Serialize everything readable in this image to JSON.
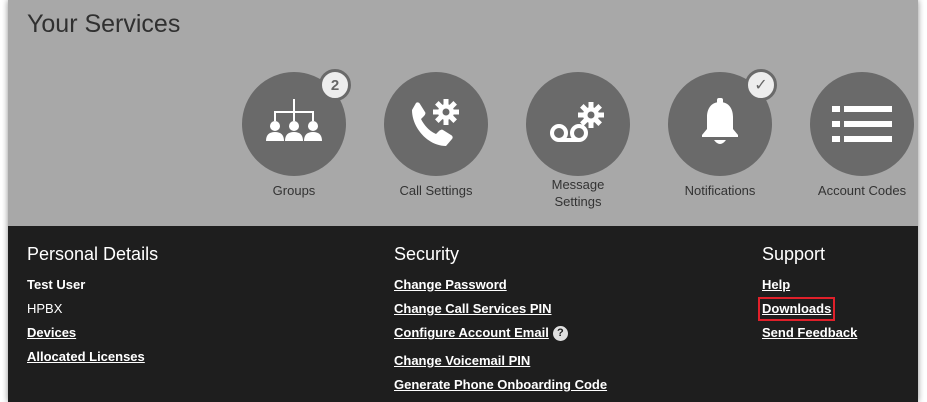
{
  "services": {
    "title": "Your Services",
    "tiles": [
      {
        "label": "Groups",
        "icon": "groups-icon",
        "badge": "2"
      },
      {
        "label": "Call Settings",
        "icon": "call-settings-icon"
      },
      {
        "label": "Message\nSettings",
        "icon": "voicemail-settings-icon"
      },
      {
        "label": "Notifications",
        "icon": "bell-icon",
        "badge": "✓"
      },
      {
        "label": "Account Codes",
        "icon": "list-icon"
      }
    ]
  },
  "personal": {
    "title": "Personal Details",
    "name": "Test User",
    "product": "HPBX",
    "devices": "Devices",
    "licenses": "Allocated Licenses"
  },
  "security": {
    "title": "Security",
    "change_password": "Change Password",
    "change_pin": "Change Call Services PIN",
    "configure_email": "Configure Account Email",
    "help_glyph": "?",
    "change_voicemail_pin": "Change Voicemail PIN",
    "onboarding_code": "Generate Phone Onboarding Code"
  },
  "support": {
    "title": "Support",
    "help": "Help",
    "downloads": "Downloads",
    "feedback": "Send Feedback"
  },
  "colors": {
    "services_bg": "#a8a8a8",
    "tile_circle": "#6a6a6a",
    "details_bg": "#1e1e1e",
    "highlight": "#e0202a"
  }
}
